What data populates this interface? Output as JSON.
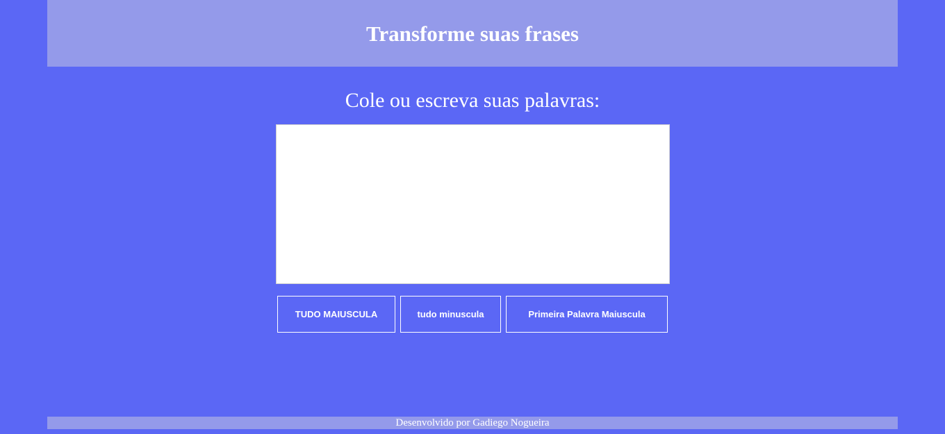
{
  "header": {
    "title": "Transforme suas frases"
  },
  "main": {
    "prompt": "Cole ou escreva suas palavras:",
    "textarea_value": "",
    "buttons": {
      "upper": "TUDO MAIUSCULA",
      "lower": "tudo minuscula",
      "title_case": "Primeira Palavra Maiuscula"
    }
  },
  "footer": {
    "credit": "Desenvolvido por Gadiego Nogueira"
  },
  "colors": {
    "background": "#5b67f5",
    "header_bg": "#949aea",
    "footer_bg": "#949aea",
    "text": "#ffffff"
  }
}
